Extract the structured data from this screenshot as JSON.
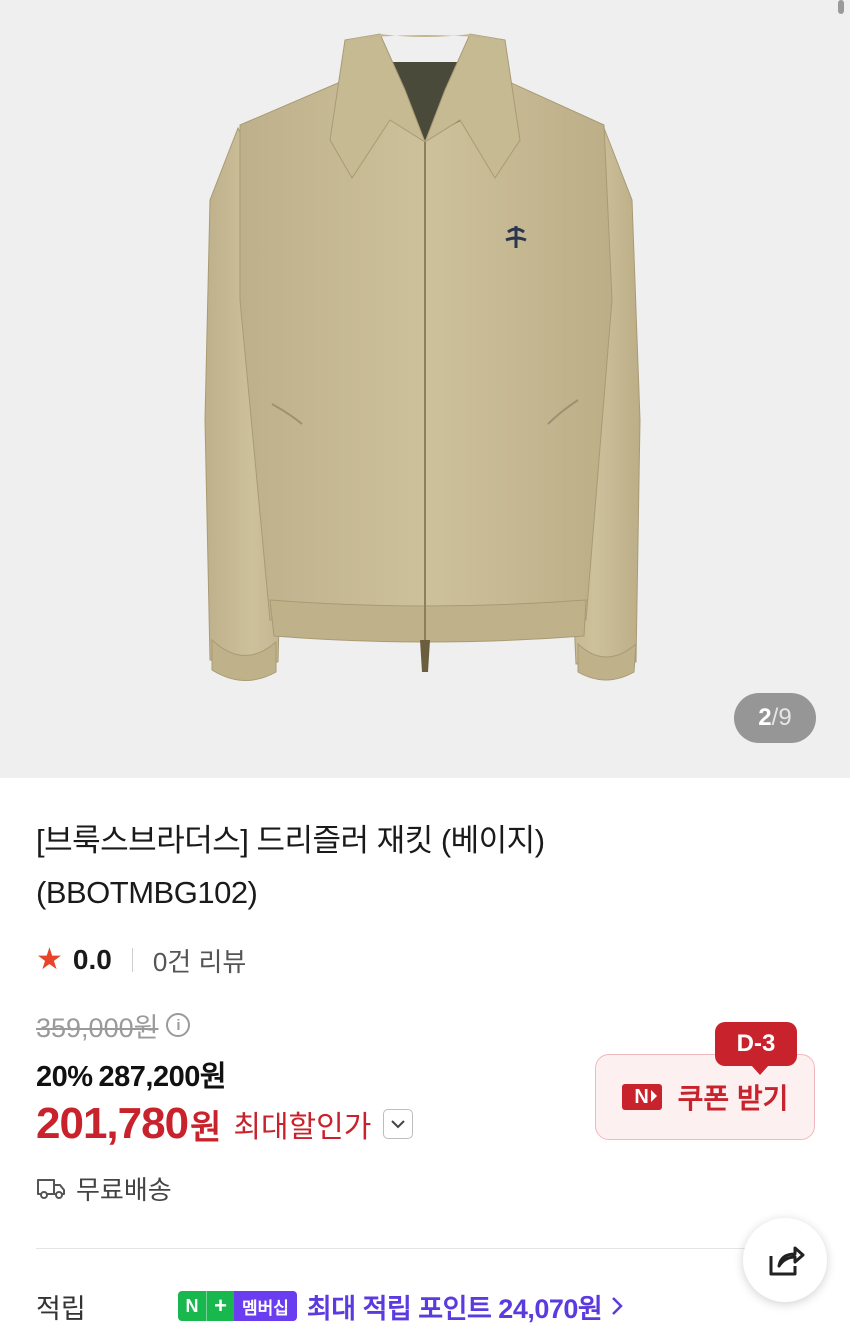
{
  "gallery": {
    "image_alt": "beige drizzler jacket product photo",
    "current_index": "2",
    "separator": "/",
    "total": "9"
  },
  "product": {
    "title_line1": "[브룩스브라더스] 드리즐러 재킷 (베이지)",
    "title_line2": "(BBOTMBG102)"
  },
  "rating": {
    "icon": "star-icon",
    "score": "0.0",
    "review_count": "0건 리뷰"
  },
  "price": {
    "original": "359,000원",
    "discount_percent": "20%",
    "sale_price": "287,200원",
    "final_amount": "201,780",
    "final_unit": "원",
    "final_label": "최대할인가"
  },
  "coupon": {
    "dday": "D-3",
    "logo_text": "N",
    "label": "쿠폰 받기"
  },
  "shipping": {
    "label": "무료배송"
  },
  "points": {
    "label": "적립",
    "badge_n": "N",
    "badge_plus": "+",
    "badge_membership": "멤버십",
    "text": "최대 적립 포인트 24,070원"
  },
  "colors": {
    "accent_red": "#c8232c",
    "star": "#e8442a",
    "membership_purple": "#5b3be0",
    "npay_green": "#19b84f",
    "jacket_beige": "#c9bd95"
  }
}
